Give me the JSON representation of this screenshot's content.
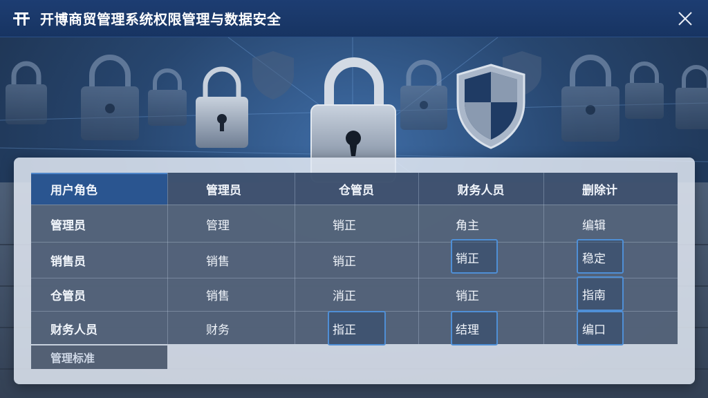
{
  "window": {
    "title": "开博商贸管理系统权限管理与数据安全",
    "logo_icon": "app-logo-icon",
    "close_icon": "close-icon"
  },
  "colors": {
    "titlebar": "#1d3d72",
    "header_accent": "#2a5590",
    "selection_border": "#4f8fd6",
    "panel": "#e1e8f2"
  },
  "table": {
    "headers": [
      "用户角色",
      "管理员",
      "仓管员",
      "财务人员",
      "删除计"
    ],
    "rows": [
      {
        "role": "管理员",
        "cells": [
          "管理",
          "销正",
          "角主",
          "编辑"
        ]
      },
      {
        "role": "销售员",
        "cells": [
          "销售",
          "销正",
          "销正",
          "稳定"
        ]
      },
      {
        "role": "仓管员",
        "cells": [
          "销售",
          "消正",
          "销正",
          "指南"
        ]
      },
      {
        "role": "财务人员",
        "cells": [
          "财务",
          "指正",
          "结理",
          "编口"
        ]
      }
    ],
    "footer_tab": "管理标准"
  }
}
